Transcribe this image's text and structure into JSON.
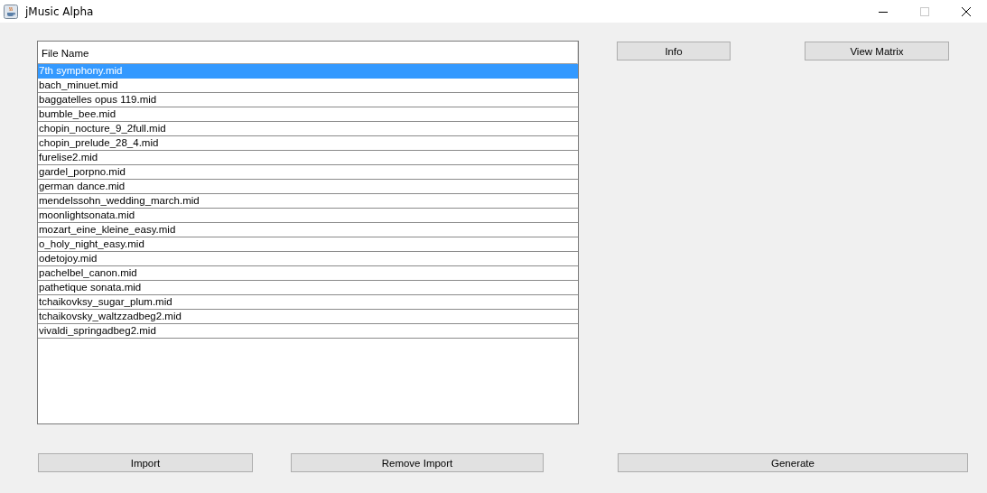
{
  "window": {
    "title": "jMusic Alpha",
    "maximize_disabled": true
  },
  "table": {
    "columns": [
      "File Name"
    ],
    "rows": [
      {
        "name": "7th symphony.mid",
        "selected": true
      },
      {
        "name": "bach_minuet.mid",
        "selected": false
      },
      {
        "name": "baggatelles opus 119.mid",
        "selected": false
      },
      {
        "name": "bumble_bee.mid",
        "selected": false
      },
      {
        "name": "chopin_nocture_9_2full.mid",
        "selected": false
      },
      {
        "name": "chopin_prelude_28_4.mid",
        "selected": false
      },
      {
        "name": "furelise2.mid",
        "selected": false
      },
      {
        "name": "gardel_porpno.mid",
        "selected": false
      },
      {
        "name": "german dance.mid",
        "selected": false
      },
      {
        "name": "mendelssohn_wedding_march.mid",
        "selected": false
      },
      {
        "name": "moonlightsonata.mid",
        "selected": false
      },
      {
        "name": "mozart_eine_kleine_easy.mid",
        "selected": false
      },
      {
        "name": "o_holy_night_easy.mid",
        "selected": false
      },
      {
        "name": "odetojoy.mid",
        "selected": false
      },
      {
        "name": "pachelbel_canon.mid",
        "selected": false
      },
      {
        "name": "pathetique sonata.mid",
        "selected": false
      },
      {
        "name": "tchaikovksy_sugar_plum.mid",
        "selected": false
      },
      {
        "name": "tchaikovsky_waltzzadbeg2.mid",
        "selected": false
      },
      {
        "name": "vivaldi_springadbeg2.mid",
        "selected": false
      }
    ]
  },
  "top_buttons": [
    "Info",
    "View Matrix"
  ],
  "bottom_buttons": [
    "Import",
    "Remove Import",
    "Generate"
  ]
}
